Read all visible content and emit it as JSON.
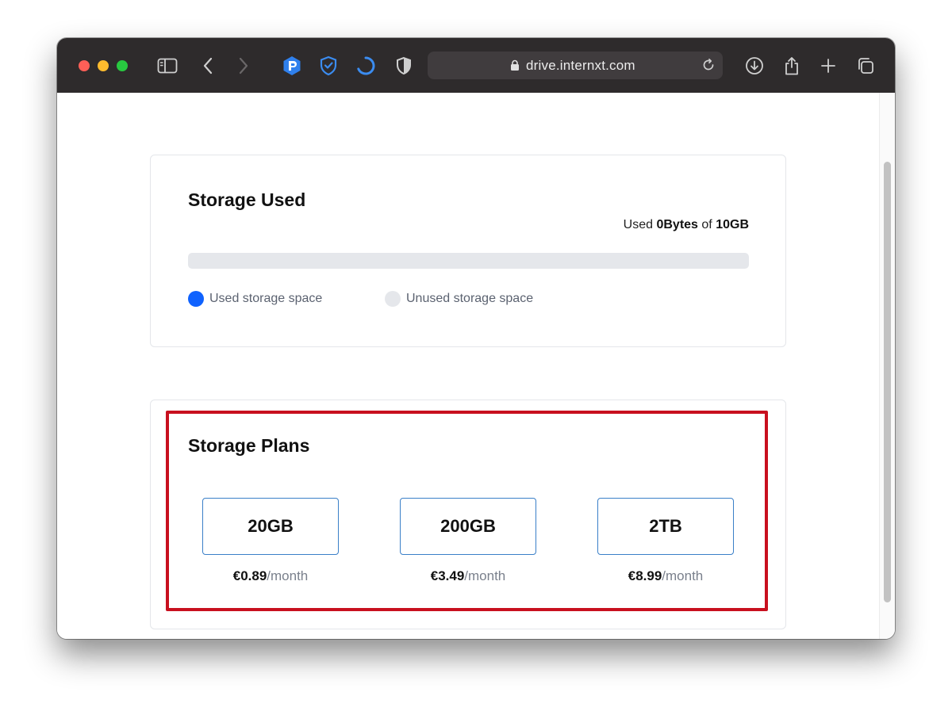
{
  "browser": {
    "url": "drive.internxt.com"
  },
  "storage_used": {
    "title": "Storage Used",
    "used_prefix": "Used",
    "used_amount": "0Bytes",
    "used_of": "of",
    "total_amount": "10GB",
    "usage_fraction": 0,
    "legend_used": "Used storage space",
    "legend_unused": "Unused storage space",
    "colors": {
      "used": "#0f62fe",
      "unused": "#e5e7eb"
    }
  },
  "storage_plans": {
    "title": "Storage Plans",
    "plans": [
      {
        "size": "20GB",
        "price": "€0.89",
        "period": "/month"
      },
      {
        "size": "200GB",
        "price": "€3.49",
        "period": "/month"
      },
      {
        "size": "2TB",
        "price": "€8.99",
        "period": "/month"
      }
    ],
    "highlight_color": "#c8101f"
  }
}
